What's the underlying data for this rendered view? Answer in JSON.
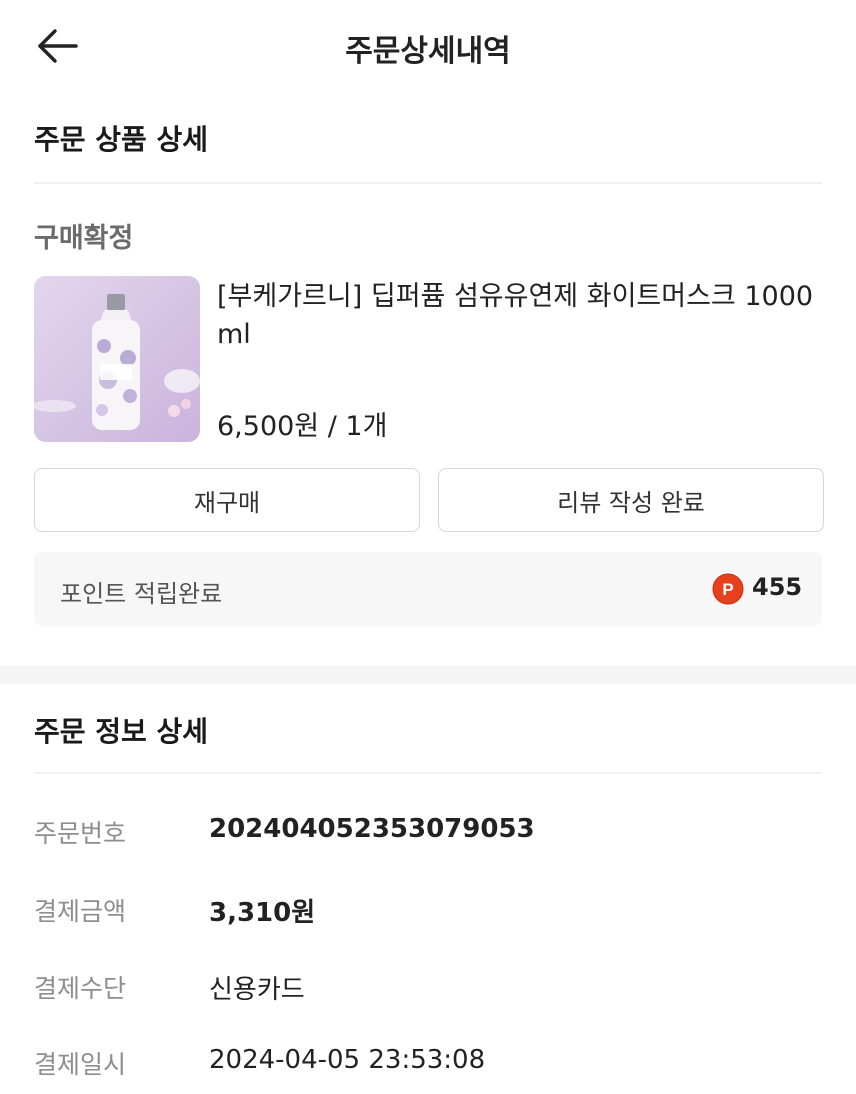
{
  "header": {
    "title": "주문상세내역",
    "back_icon": "arrow-left-icon"
  },
  "product_section": {
    "title": "주문 상품 상세",
    "status": "구매확정",
    "product": {
      "name": "[부케가르니] 딥퍼퓸 섬유유연제 화이트머스크 1000ml",
      "price_qty": "6,500원 / 1개"
    },
    "buttons": {
      "rebuy": "재구매",
      "review": "리뷰 작성 완료"
    },
    "points": {
      "label": "포인트 적립완료",
      "icon_letter": "P",
      "value": "455",
      "icon_color": "#e8401c"
    }
  },
  "order_info": {
    "title": "주문 정보 상세",
    "rows": [
      {
        "label": "주문번호",
        "value": "20240405235307905​3"
      },
      {
        "label": "결제금액",
        "value": "3,310원"
      },
      {
        "label": "결제수단",
        "value": "신용카드"
      },
      {
        "label": "결제일시",
        "value": "2024-04-05 23:53:08"
      }
    ]
  }
}
